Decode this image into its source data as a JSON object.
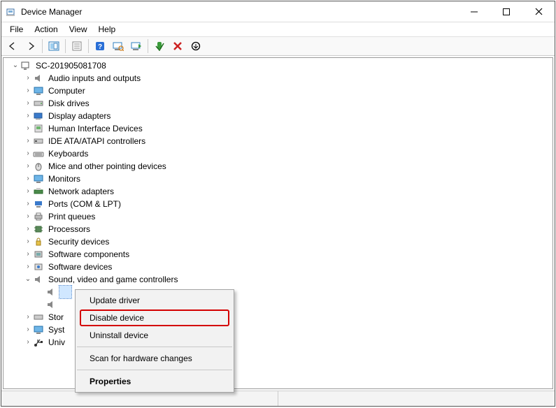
{
  "window": {
    "title": "Device Manager"
  },
  "menubar": {
    "file": "File",
    "action": "Action",
    "view": "View",
    "help": "Help"
  },
  "tree": {
    "root": "SC-201905081708",
    "items": [
      "Audio inputs and outputs",
      "Computer",
      "Disk drives",
      "Display adapters",
      "Human Interface Devices",
      "IDE ATA/ATAPI controllers",
      "Keyboards",
      "Mice and other pointing devices",
      "Monitors",
      "Network adapters",
      "Ports (COM & LPT)",
      "Print queues",
      "Processors",
      "Security devices",
      "Software components",
      "Software devices",
      "Sound, video and game controllers",
      "Stor",
      "Syst",
      "Univ"
    ]
  },
  "context_menu": {
    "update_driver": "Update driver",
    "disable_device": "Disable device",
    "uninstall_device": "Uninstall device",
    "scan_hardware": "Scan for hardware changes",
    "properties": "Properties"
  }
}
